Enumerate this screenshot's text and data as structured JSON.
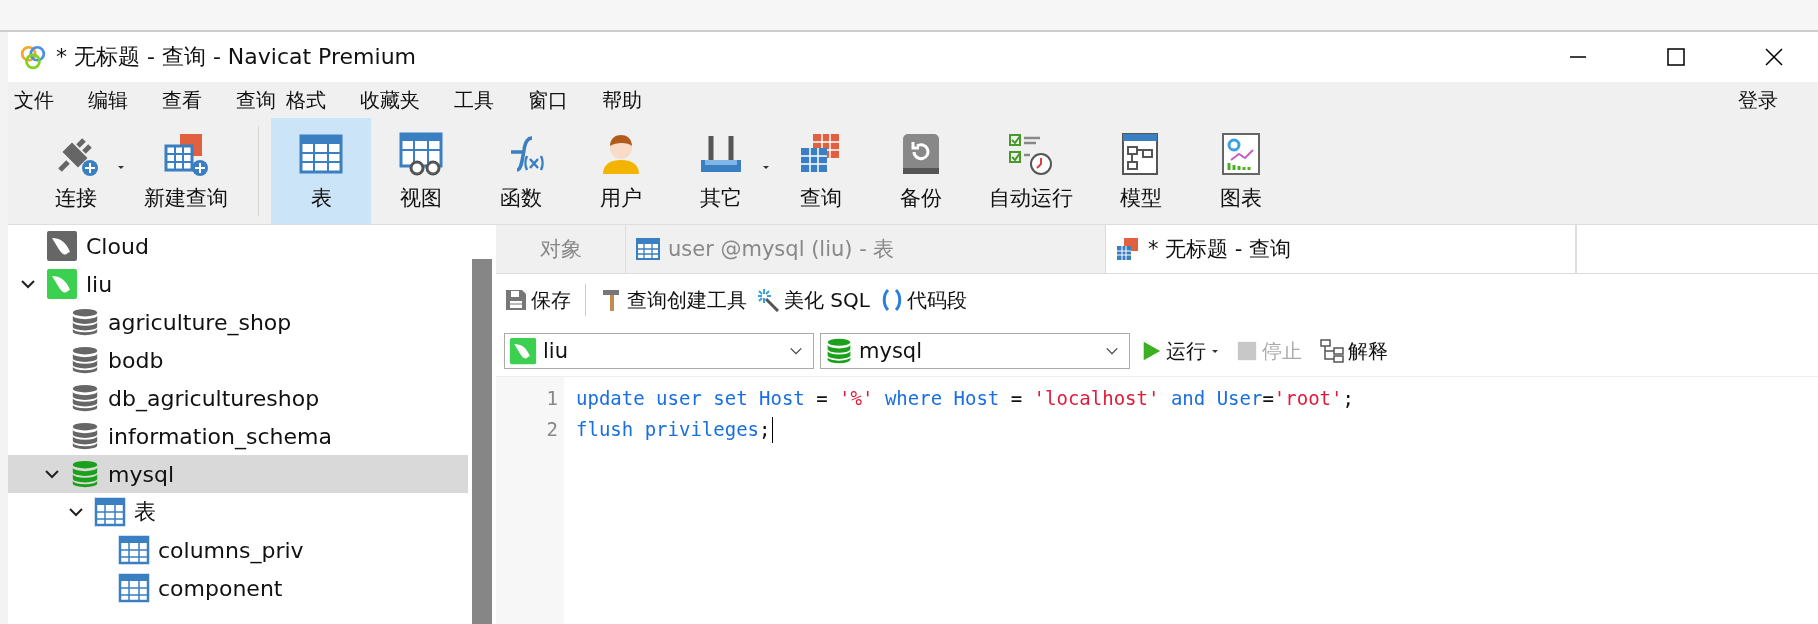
{
  "window": {
    "title": "* 无标题 - 查询 - Navicat Premium"
  },
  "menu": [
    "文件",
    "编辑",
    "查看",
    "查询",
    "格式",
    "收藏夹",
    "工具",
    "窗口",
    "帮助"
  ],
  "login": "登录",
  "toolbar": [
    {
      "label": "连接",
      "caret": true,
      "selected": false
    },
    {
      "label": "新建查询",
      "caret": false,
      "selected": false
    },
    {
      "label": "表",
      "caret": false,
      "selected": true
    },
    {
      "label": "视图",
      "caret": false,
      "selected": false
    },
    {
      "label": "函数",
      "caret": false,
      "selected": false
    },
    {
      "label": "用户",
      "caret": false,
      "selected": false
    },
    {
      "label": "其它",
      "caret": true,
      "selected": false
    },
    {
      "label": "查询",
      "caret": false,
      "selected": false
    },
    {
      "label": "备份",
      "caret": false,
      "selected": false
    },
    {
      "label": "自动运行",
      "caret": false,
      "selected": false
    },
    {
      "label": "模型",
      "caret": false,
      "selected": false
    },
    {
      "label": "图表",
      "caret": false,
      "selected": false
    }
  ],
  "tree": [
    {
      "label": "Cloud",
      "kind": "connection",
      "open": false,
      "selected": false,
      "expanded": false
    },
    {
      "label": "liu",
      "kind": "connection",
      "open": true,
      "selected": false,
      "expanded": true,
      "children": [
        {
          "label": "agriculture_shop",
          "kind": "database",
          "open": false,
          "selected": false,
          "expanded": false
        },
        {
          "label": "bodb",
          "kind": "database",
          "open": false,
          "selected": false,
          "expanded": false
        },
        {
          "label": "db_agricultureshop",
          "kind": "database",
          "open": false,
          "selected": false,
          "expanded": false
        },
        {
          "label": "information_schema",
          "kind": "database",
          "open": false,
          "selected": false,
          "expanded": false
        },
        {
          "label": "mysql",
          "kind": "database",
          "open": true,
          "selected": true,
          "expanded": true,
          "children": [
            {
              "label": "表",
              "kind": "table",
              "selected": false,
              "expanded": true,
              "children": [
                {
                  "label": "columns_priv",
                  "kind": "table",
                  "selected": false,
                  "expanded": false
                },
                {
                  "label": "component",
                  "kind": "table",
                  "selected": false,
                  "expanded": false
                }
              ]
            }
          ]
        }
      ]
    }
  ],
  "tabs": [
    {
      "label": "对象",
      "selected": false
    },
    {
      "label": "user @mysql (liu) - 表",
      "selected": false
    },
    {
      "label": "* 无标题 - 查询",
      "selected": true
    }
  ],
  "editor_toolbar": [
    "保存",
    "查询创建工具",
    "美化 SQL",
    "代码段"
  ],
  "connection_select": {
    "value": "liu"
  },
  "database_select": {
    "value": "mysql"
  },
  "actions": [
    {
      "label": "运行",
      "caret": true,
      "disabled": false
    },
    {
      "label": "停止",
      "caret": false,
      "disabled": true
    },
    {
      "label": "解释",
      "caret": false,
      "disabled": false
    }
  ],
  "code": [
    {
      "number": "1",
      "tokens": [
        {
          "kind": "keyword",
          "text": "update user set Host"
        },
        {
          "kind": "plain",
          "text": " = "
        },
        {
          "kind": "string",
          "text": "'%'"
        },
        {
          "kind": "keyword",
          "text": " where Host"
        },
        {
          "kind": "plain",
          "text": " = "
        },
        {
          "kind": "string",
          "text": "'localhost'"
        },
        {
          "kind": "keyword",
          "text": " and User"
        },
        {
          "kind": "plain",
          "text": "="
        },
        {
          "kind": "string",
          "text": "'root'"
        },
        {
          "kind": "plain",
          "text": ";"
        }
      ]
    },
    {
      "number": "2",
      "tokens": [
        {
          "kind": "keyword",
          "text": "flush privileges"
        },
        {
          "kind": "plain",
          "text": ";"
        }
      ],
      "cursor": true
    }
  ]
}
